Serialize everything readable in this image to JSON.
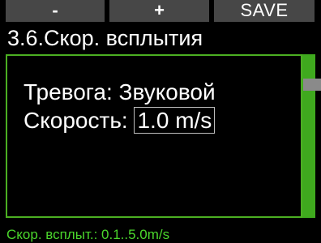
{
  "softkeys": {
    "minus": "-",
    "plus": "+",
    "save": "SAVE"
  },
  "title": "3.6.Скор. всплытия",
  "settings": {
    "alarm_label": "Тревога:",
    "alarm_value": "Звуковой",
    "speed_label": "Скорость:",
    "speed_value": "1.0 m/s"
  },
  "hint": "Скор. всплыт.: 0.1..5.0m/s",
  "colors": {
    "accent": "#4caf22",
    "hint_text": "#4bd62c",
    "softkey_bg": "#474747"
  }
}
